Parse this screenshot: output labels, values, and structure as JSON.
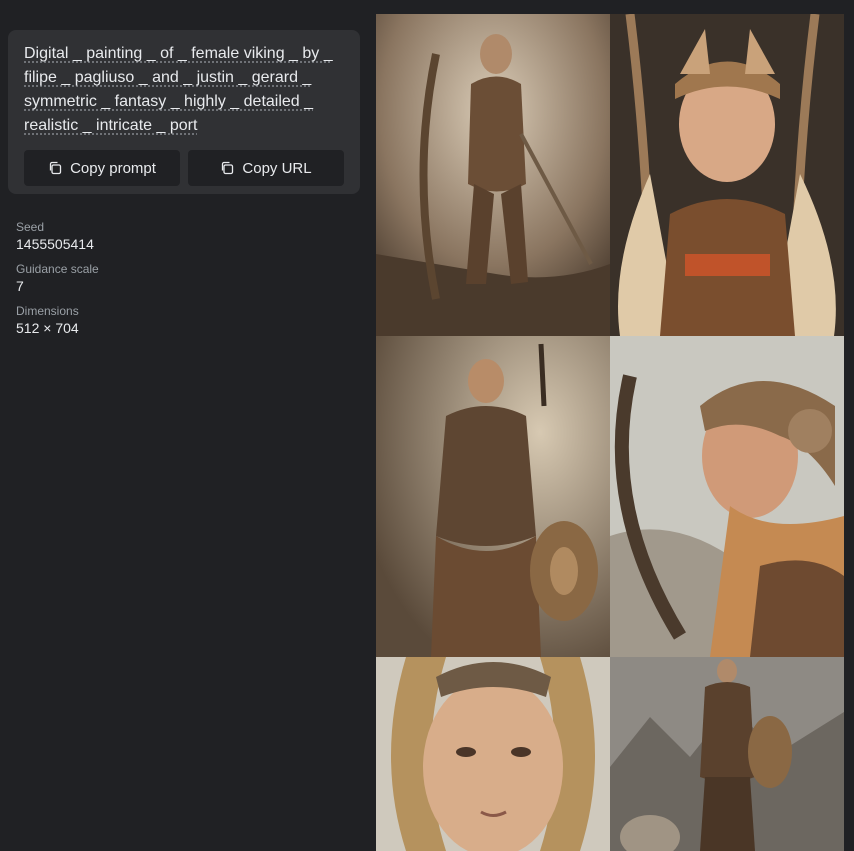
{
  "prompt": {
    "text": "Digital _ painting _ of _ female viking _ by _ filipe _ pagliuso _ and _ justin _ gerard _ symmetric _ fantasy _ highly _ detailed _ realistic _ intricate _ port",
    "copy_prompt_label": "Copy prompt",
    "copy_url_label": "Copy URL"
  },
  "meta": [
    {
      "label": "Seed",
      "value": "1455505414"
    },
    {
      "label": "Guidance scale",
      "value": "7"
    },
    {
      "label": "Dimensions",
      "value": "512 × 704"
    }
  ],
  "colors": {
    "background": "#202124",
    "card": "#303134",
    "button": "#202124",
    "text": "#e8eaed",
    "muted": "#9aa0a6"
  },
  "icons": {
    "copy": "copy-icon"
  }
}
